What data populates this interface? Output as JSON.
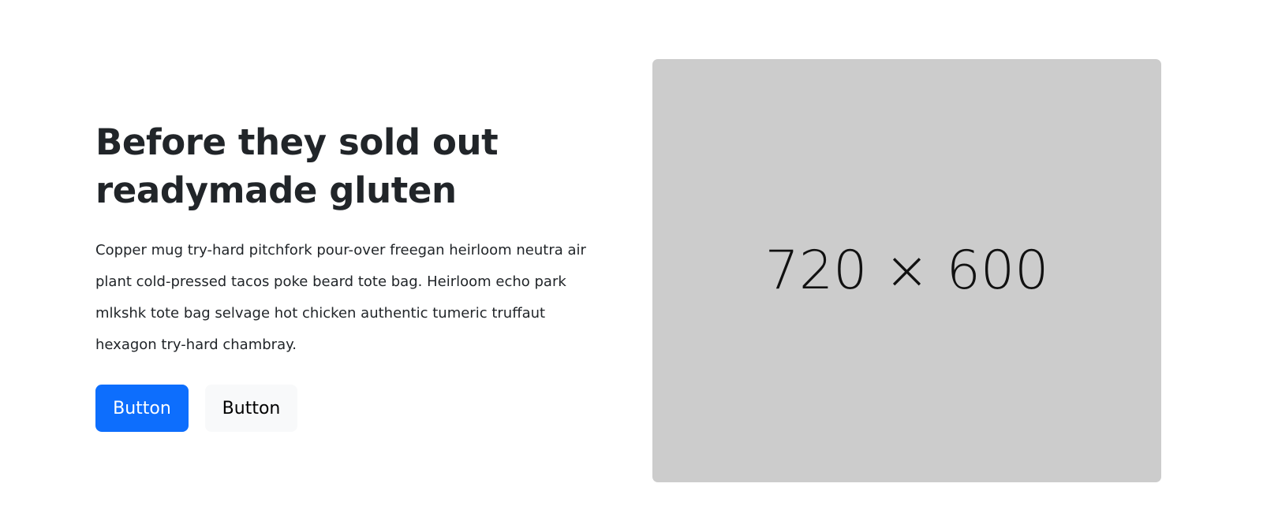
{
  "hero": {
    "title": "Before they sold out readymade gluten",
    "description": "Copper mug try-hard pitchfork pour-over freegan heirloom neutra air plant cold-pressed tacos poke beard tote bag. Heirloom echo park mlkshk tote bag selvage hot chicken authentic tumeric truffaut hexagon try-hard chambray.",
    "primary_button_label": "Button",
    "secondary_button_label": "Button",
    "image_placeholder_label": "720 × 600"
  },
  "colors": {
    "primary": "#0d6efd",
    "secondary_button_bg": "#f8f9fa",
    "image_placeholder_bg": "#cccccc",
    "text": "#212529"
  }
}
